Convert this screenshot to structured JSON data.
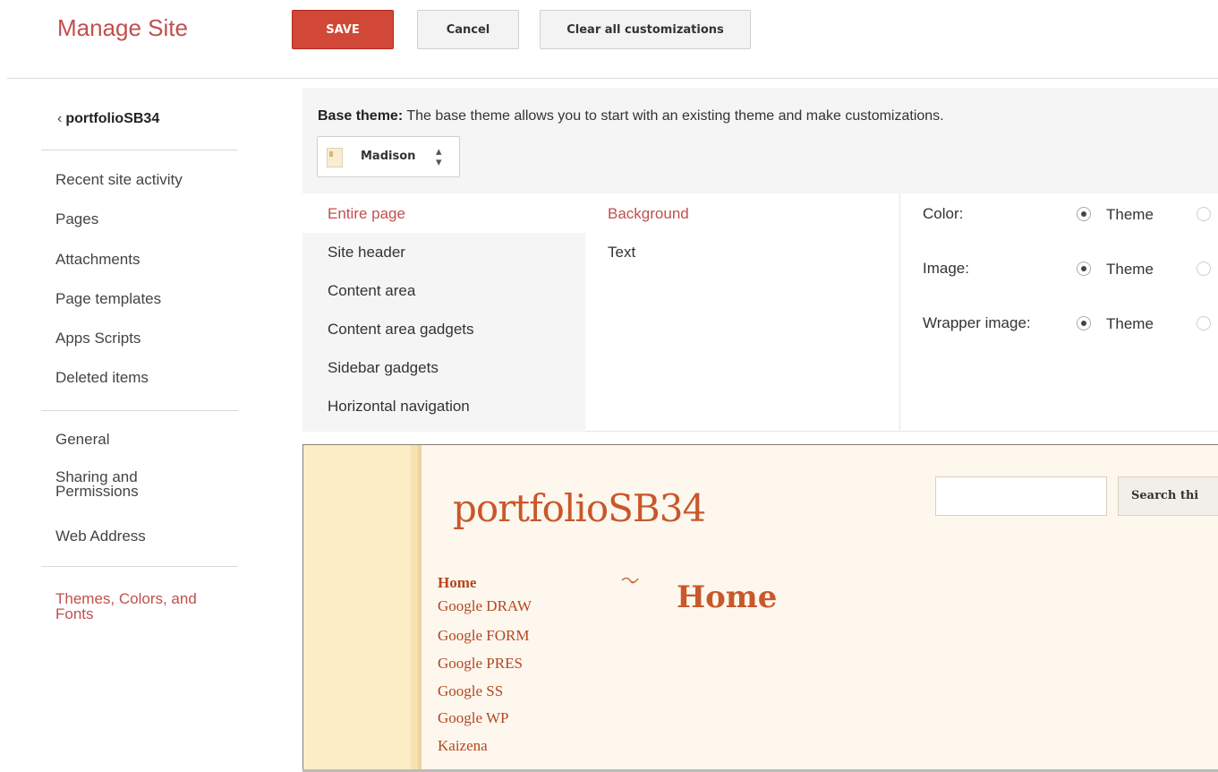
{
  "header": {
    "title": "Manage Site",
    "save_label": "SAVE",
    "cancel_label": "Cancel",
    "clear_label": "Clear all customizations"
  },
  "sidebar": {
    "site_name": "portfolioSB34",
    "back_icon": "chevron-left-icon",
    "group1": [
      "Recent site activity",
      "Pages",
      "Attachments",
      "Page templates",
      "Apps Scripts",
      "Deleted items"
    ],
    "group2": [
      "General",
      "Sharing and",
      "Permissions",
      "Web Address"
    ],
    "active_item": "Themes, Colors, and Fonts",
    "active_item_lines": [
      "Themes, Colors, and",
      "Fonts"
    ]
  },
  "base_theme": {
    "label": "Base theme:",
    "description": " The base theme allows you to start with an existing theme and make customizations.",
    "selected": "Madison"
  },
  "sections": [
    "Entire page",
    "Site header",
    "Content area",
    "Content area gadgets",
    "Sidebar gadgets",
    "Horizontal navigation"
  ],
  "properties": [
    "Background",
    "Text"
  ],
  "options": [
    {
      "label": "Color:",
      "choice": "Theme"
    },
    {
      "label": "Image:",
      "choice": "Theme"
    },
    {
      "label": "Wrapper image:",
      "choice": "Theme"
    }
  ],
  "preview": {
    "site_title": "portfolioSB34",
    "search_button": "Search thi",
    "page_title": "Home",
    "nav_items": [
      "Home",
      "Google DRAW",
      "Google FORM",
      "Google PRES",
      "Google SS",
      "Google WP",
      "Kaizena"
    ]
  },
  "colors": {
    "accent": "#c0504d",
    "save_button": "#d14836",
    "preview_title": "#c8582b"
  }
}
